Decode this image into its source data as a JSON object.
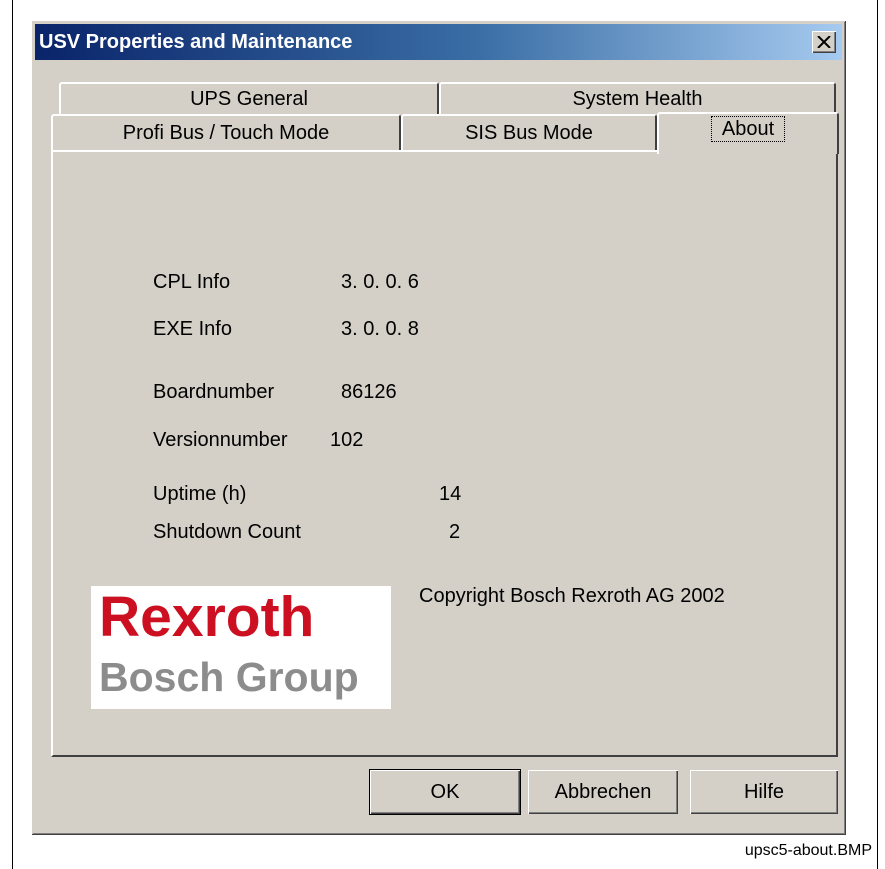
{
  "window": {
    "title": "USV Properties and Maintenance",
    "close_icon": "close-icon"
  },
  "tabs": {
    "row1": [
      {
        "label": "UPS General"
      },
      {
        "label": "System Health"
      }
    ],
    "row2": [
      {
        "label": "Profi Bus / Touch Mode"
      },
      {
        "label": "SIS Bus Mode"
      },
      {
        "label": "About",
        "active": true
      }
    ]
  },
  "about": {
    "cpl_label": "CPL Info",
    "cpl_value": "3. 0. 0. 6",
    "exe_label": "EXE Info",
    "exe_value": "3. 0. 0. 8",
    "board_label": "Boardnumber",
    "board_value": "86126",
    "version_label": "Versionnumber",
    "version_value": "102",
    "uptime_label": "Uptime (h)",
    "uptime_value": "14",
    "shutdown_label": "Shutdown Count",
    "shutdown_value": "2",
    "copyright": "Copyright Bosch Rexroth AG 2002",
    "logo": {
      "line1": "Rexroth",
      "line2": "Bosch Group",
      "colors": {
        "line1": "#cc1022",
        "line2": "#8c8c8c"
      }
    }
  },
  "buttons": {
    "ok": "OK",
    "cancel": "Abbrechen",
    "help": "Hilfe"
  },
  "caption": "upsc5-about.BMP",
  "colors": {
    "dialog_face": "#d4d0c8",
    "titlebar_start": "#0a246a",
    "titlebar_end": "#a6caf0"
  }
}
